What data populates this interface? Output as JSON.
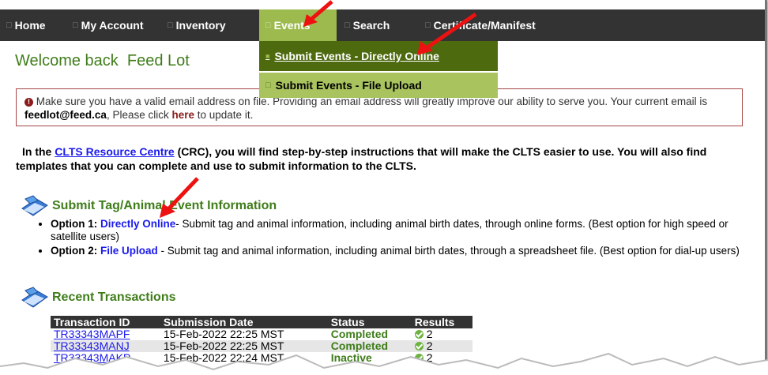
{
  "nav": {
    "items": [
      {
        "label": "Home"
      },
      {
        "label": "My Account"
      },
      {
        "label": "Inventory"
      },
      {
        "label": "Events"
      },
      {
        "label": "Search"
      },
      {
        "label": "Certificate/Manifest"
      }
    ],
    "bullet": "□",
    "active_color": "#9dba4e"
  },
  "dropdown": {
    "items": [
      {
        "label": "Submit Events - Directly Online"
      },
      {
        "label": "Submit Events - File Upload"
      }
    ]
  },
  "welcome": "Welcome back  Feed Lot",
  "alert": {
    "text1": " Make sure you have a valid email address on file. Providing an email address will greatly improve our ability to serve you. Your current email is ",
    "email": "feedlot@feed.ca",
    "text2": ", Please click ",
    "link": "here",
    "text3": " to update it."
  },
  "crc": {
    "prefix": "In the ",
    "link": "CLTS Resource Centre",
    "suffix": " (CRC), you will find step-by-step instructions that will make the CLTS easier to use. You will also find templates that you can complete and use to submit information to the CLTS."
  },
  "submit_section": {
    "title": "Submit Tag/Animal Event Information",
    "options": [
      {
        "label": "Option 1:",
        "link": "Directly Online",
        "text": "- Submit tag and animal information, including animal birth dates, through online forms. (Best option for high speed or satellite users)"
      },
      {
        "label": "Option 2:",
        "link": "File Upload",
        "text": " - Submit tag and animal information, including animal birth dates, through a spreadsheet file. (Best option for dial-up users)"
      }
    ]
  },
  "recent": {
    "title": "Recent Transactions",
    "columns": [
      "Transaction ID",
      "Submission Date",
      "Status",
      "Results"
    ],
    "rows": [
      {
        "id": "TR33343MAPF",
        "date": "15-Feb-2022 22:25 MST",
        "status": "Completed",
        "results": "2"
      },
      {
        "id": "TR33343MANJ",
        "date": "15-Feb-2022 22:25 MST",
        "status": "Completed",
        "results": "2"
      },
      {
        "id": "TR33343MAKP",
        "date": "15-Feb-2022 22:24 MST",
        "status": "Inactive",
        "results": "2"
      }
    ]
  },
  "colors": {
    "green_heading": "#3f7d1a",
    "link_blue": "#1a1aee",
    "arrow_red": "#ee1111"
  }
}
